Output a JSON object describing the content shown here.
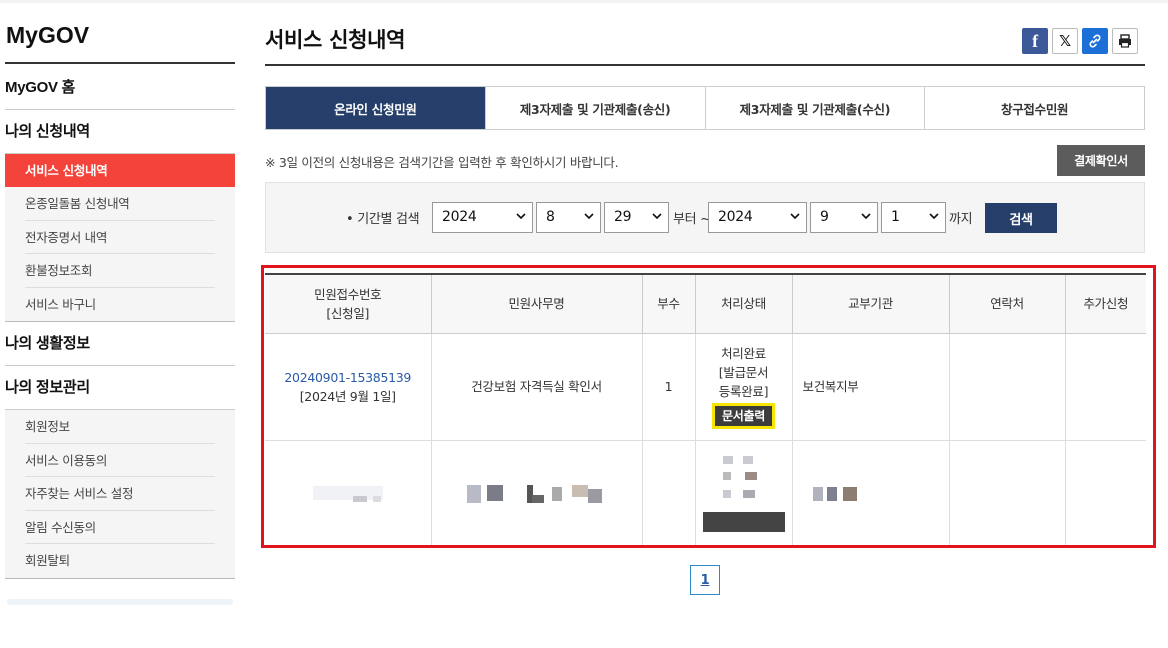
{
  "brand": "MyGOV",
  "sidebar": {
    "home": "MyGOV 홈",
    "section_apply": "나의 신청내역",
    "apply_items": [
      "서비스 신청내역",
      "온종일돌봄 신청내역",
      "전자증명서 내역",
      "환불정보조회",
      "서비스 바구니"
    ],
    "section_life": "나의 생활정보",
    "section_info": "나의 정보관리",
    "info_items": [
      "회원정보",
      "서비스 이용동의",
      "자주찾는 서비스 설정",
      "알림 수신동의",
      "회원탈퇴"
    ]
  },
  "page_title": "서비스 신청내역",
  "share_icons": [
    "facebook-icon",
    "x-icon",
    "link-icon",
    "print-icon"
  ],
  "tabs": [
    "온라인 신청민원",
    "제3자제출 및 기관제출(송신)",
    "제3자제출 및 기관제출(수신)",
    "창구접수민원"
  ],
  "active_tab": "온라인 신청민원",
  "notice": "※ 3일 이전의 신청내용은 검색기간을 입력한 후 확인하시기 바랍니다.",
  "pay_button": "결제확인서",
  "search": {
    "label": "기간별 검색",
    "from_year": "2024",
    "from_month": "8",
    "from_day": "29",
    "from_suffix": "부터 ~",
    "to_year": "2024",
    "to_month": "9",
    "to_day": "1",
    "to_suffix": "까지",
    "button": "검색"
  },
  "table": {
    "headers": [
      "민원접수번호",
      "[신청일]",
      "민원사무명",
      "부수",
      "처리상태",
      "교부기관",
      "연락처",
      "추가신청"
    ],
    "row1": {
      "receipt_no": "20240901-15385139",
      "date": "[2024년 9월 1일]",
      "service": "건강보험 자격득실 확인서",
      "copies": "1",
      "status1": "처리완료",
      "status2": "[발급문서",
      "status3": "등록완료]",
      "print_button": "문서출력",
      "agency": "보건복지부",
      "contact": "",
      "extra": ""
    }
  },
  "pagination": {
    "current": "1"
  },
  "colors": {
    "accent_navy": "#253e6a",
    "active_red": "#f4433a",
    "highlight_outline": "#e0141e",
    "print_highlight": "#f5e500"
  }
}
